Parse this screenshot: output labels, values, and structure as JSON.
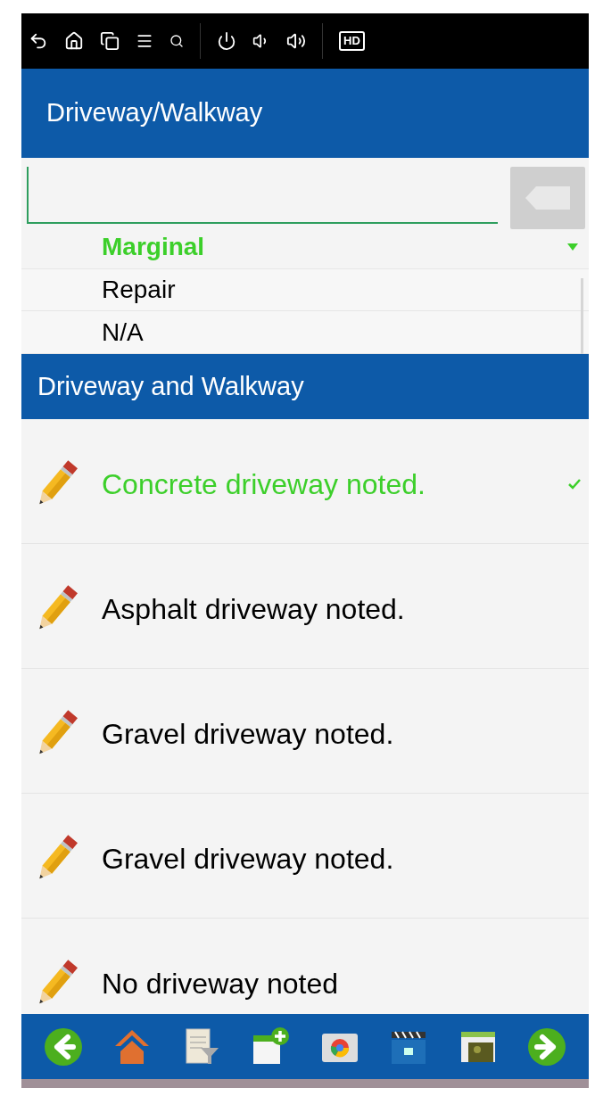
{
  "status_bar": {
    "hd_badge": "HD"
  },
  "header": {
    "title": "Driveway/Walkway"
  },
  "options": [
    {
      "label": "Marginal",
      "selected": true
    },
    {
      "label": "Repair",
      "selected": false
    },
    {
      "label": "N/A",
      "selected": false
    }
  ],
  "section": {
    "title": "Driveway and Walkway"
  },
  "comments": [
    {
      "text": "Concrete driveway noted.",
      "selected": true
    },
    {
      "text": "Asphalt driveway noted.",
      "selected": false
    },
    {
      "text": "Gravel driveway noted.",
      "selected": false
    },
    {
      "text": "Gravel driveway noted.",
      "selected": false
    },
    {
      "text": "No driveway noted",
      "selected": false
    }
  ]
}
